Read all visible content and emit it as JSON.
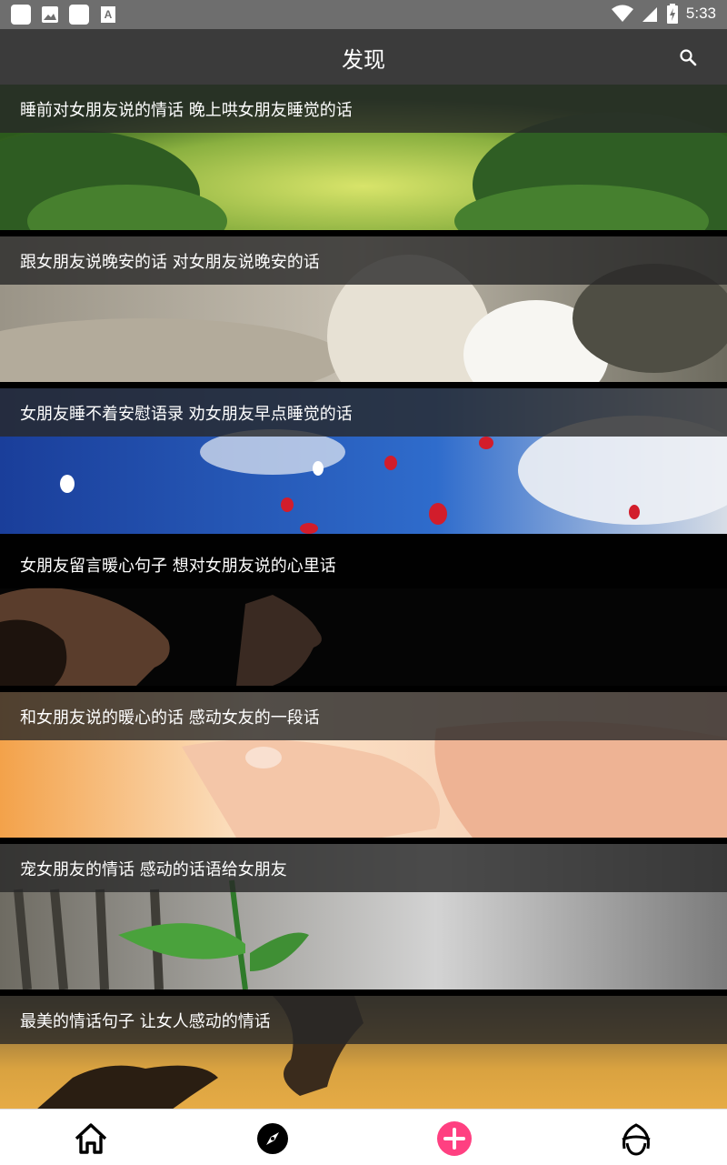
{
  "status_bar": {
    "time": "5:33",
    "icons": [
      "notification-square",
      "image-icon",
      "notification-square",
      "font-icon",
      "wifi-icon",
      "signal-icon",
      "battery-charging-icon"
    ]
  },
  "header": {
    "title": "发现",
    "search_icon": "search-icon"
  },
  "feed": {
    "items": [
      {
        "title": "睡前对女朋友说的情话 晚上哄女朋友睡觉的话",
        "image": "green-hedge-bokeh"
      },
      {
        "title": "跟女朋友说晚安的话 对女朋友说晚安的话",
        "image": "white-tiger-woman-in-white-dress"
      },
      {
        "title": "女朋友睡不着安慰语录 劝女朋友早点睡觉的话",
        "image": "red-heart-balloons-blue-sky"
      },
      {
        "title": "女朋友留言暖心句子 想对女朋友说的心里话",
        "image": "two-faces-in-dark"
      },
      {
        "title": "和女朋友说的暖心的话 感动女友的一段话",
        "image": "hands-touching-warm-light"
      },
      {
        "title": "宠女朋友的情话 感动的话语给女朋友",
        "image": "green-sprout-gray-background"
      },
      {
        "title": "最美的情话句子 让女人感动的情话",
        "image": "silhouette-sunset"
      }
    ]
  },
  "bottom_nav": {
    "tabs": [
      {
        "icon": "home-icon"
      },
      {
        "icon": "compass-icon"
      },
      {
        "icon": "add-circle-icon",
        "color": "#ff4081"
      },
      {
        "icon": "profile-avatar-icon"
      }
    ]
  }
}
